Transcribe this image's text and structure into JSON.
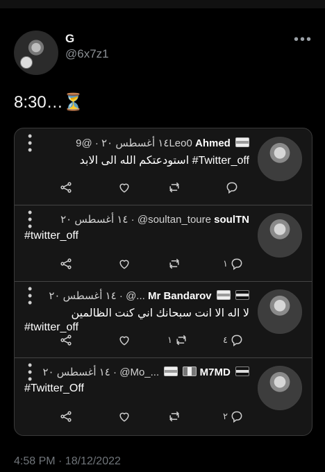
{
  "profile": {
    "name": "G",
    "handle": "@6x7z1"
  },
  "tweet": {
    "text": "8:30…⏳"
  },
  "replies": [
    {
      "display_name": "Ahmed",
      "handle": "@9Leo0",
      "date": "١٤ أغسطس ٢٠",
      "text_line1": "استودعتكم الله الى الابد #Twitter_off",
      "text_line2": "",
      "reply_count": "",
      "retweet_count": ""
    },
    {
      "display_name": "soulTN",
      "handle": "@soultan_toure",
      "date": "١٤ أغسطس ٢٠",
      "text_line1": "#twitter_off",
      "text_line2": "",
      "reply_count": "١",
      "retweet_count": ""
    },
    {
      "display_name": "Mr Bandarov",
      "handle": "@...",
      "date": "١٤ أغسطس ٢٠",
      "text_line1": "لا اله الا انت سبحانك اني كنت الظالمين",
      "text_line2": "#twitter_off",
      "reply_count": "٤",
      "retweet_count": "١"
    },
    {
      "display_name": "M7MD",
      "handle": "@Mo_...",
      "date": "١٤ أغسطس ٢٠",
      "text_line1": "#Twitter_Off",
      "text_line2": "",
      "reply_count": "٢",
      "retweet_count": ""
    }
  ],
  "footer": {
    "timestamp": "4:58 PM · 18/12/2022"
  },
  "icons": [
    "more-dots-icon",
    "share-icon",
    "heart-icon",
    "retweet-icon",
    "reply-icon"
  ],
  "colors": {
    "background": "#000000",
    "card": "#161616",
    "text": "#e7e9ea",
    "muted": "#70757a"
  }
}
